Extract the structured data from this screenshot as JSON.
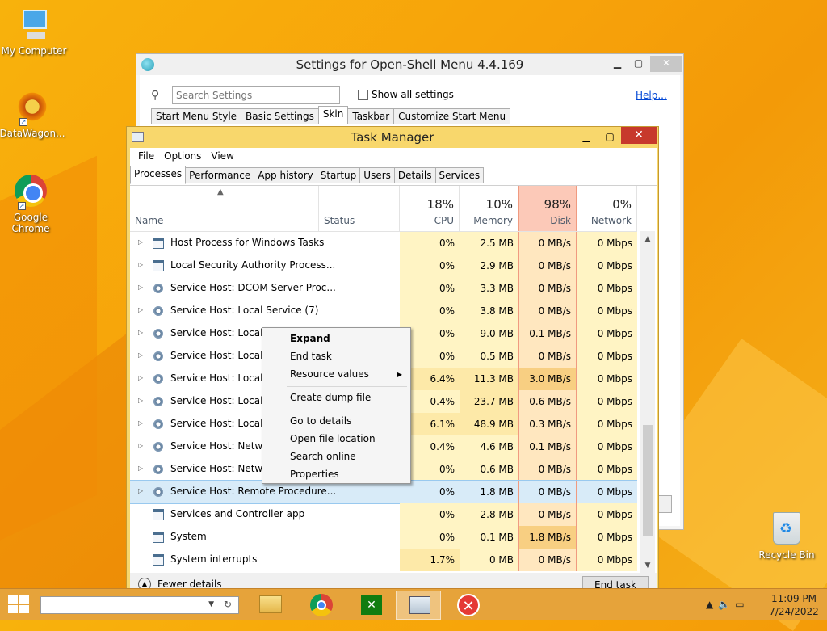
{
  "desktop": {
    "icons": [
      {
        "label": "My Computer"
      },
      {
        "label": "DataWagon..."
      },
      {
        "label": "Google Chrome"
      },
      {
        "label": "Recycle Bin"
      }
    ]
  },
  "openshell": {
    "title": "Settings for Open-Shell Menu 4.4.169",
    "search_placeholder": "Search Settings",
    "show_all_label": "Show all settings",
    "help_label": "Help...",
    "tabs": [
      "Start Menu Style",
      "Basic Settings",
      "Skin",
      "Taskbar",
      "Customize Start Menu"
    ],
    "active_tab": "Skin"
  },
  "taskmanager": {
    "title": "Task Manager",
    "menu": [
      "File",
      "Options",
      "View"
    ],
    "tabs": [
      "Processes",
      "Performance",
      "App history",
      "Startup",
      "Users",
      "Details",
      "Services"
    ],
    "active_tab": "Processes",
    "columns": {
      "name": "Name",
      "status": "Status",
      "cpu": {
        "pct": "18%",
        "label": "CPU"
      },
      "memory": {
        "pct": "10%",
        "label": "Memory"
      },
      "disk": {
        "pct": "98%",
        "label": "Disk"
      },
      "network": {
        "pct": "0%",
        "label": "Network"
      }
    },
    "rows": [
      {
        "name": "Host Process for Windows Tasks",
        "cpu": "0%",
        "mem": "2.5 MB",
        "disk": "0 MB/s",
        "net": "0 Mbps"
      },
      {
        "name": "Local Security Authority Process...",
        "cpu": "0%",
        "mem": "2.9 MB",
        "disk": "0 MB/s",
        "net": "0 Mbps"
      },
      {
        "name": "Service Host: DCOM Server Proc...",
        "cpu": "0%",
        "mem": "3.3 MB",
        "disk": "0 MB/s",
        "net": "0 Mbps"
      },
      {
        "name": "Service Host: Local Service (7)",
        "cpu": "0%",
        "mem": "3.8 MB",
        "disk": "0 MB/s",
        "net": "0 Mbps"
      },
      {
        "name": "Service Host: Local Se",
        "cpu": "0%",
        "mem": "9.0 MB",
        "disk": "0.1 MB/s",
        "net": "0 Mbps"
      },
      {
        "name": "Service Host: Local Se",
        "cpu": "0%",
        "mem": "0.5 MB",
        "disk": "0 MB/s",
        "net": "0 Mbps"
      },
      {
        "name": "Service Host: Local Se",
        "cpu": "6.4%",
        "mem": "11.3 MB",
        "disk": "3.0 MB/s",
        "net": "0 Mbps"
      },
      {
        "name": "Service Host: Local Sy",
        "cpu": "0.4%",
        "mem": "23.7 MB",
        "disk": "0.6 MB/s",
        "net": "0 Mbps"
      },
      {
        "name": "Service Host: Local Sy",
        "cpu": "6.1%",
        "mem": "48.9 MB",
        "disk": "0.3 MB/s",
        "net": "0 Mbps"
      },
      {
        "name": "Service Host: Network",
        "cpu": "0.4%",
        "mem": "4.6 MB",
        "disk": "0.1 MB/s",
        "net": "0 Mbps"
      },
      {
        "name": "Service Host: Network",
        "cpu": "0%",
        "mem": "0.6 MB",
        "disk": "0 MB/s",
        "net": "0 Mbps"
      },
      {
        "name": "Service Host: Remote Procedure...",
        "cpu": "0%",
        "mem": "1.8 MB",
        "disk": "0 MB/s",
        "net": "0 Mbps"
      },
      {
        "name": "Services and Controller app",
        "cpu": "0%",
        "mem": "2.8 MB",
        "disk": "0 MB/s",
        "net": "0 Mbps"
      },
      {
        "name": "System",
        "cpu": "0%",
        "mem": "0.1 MB",
        "disk": "1.8 MB/s",
        "net": "0 Mbps"
      },
      {
        "name": "System interrupts",
        "cpu": "1.7%",
        "mem": "0 MB",
        "disk": "0 MB/s",
        "net": "0 Mbps"
      }
    ],
    "fewer_details": "Fewer details",
    "end_task": "End task"
  },
  "context_menu": {
    "items": [
      "Expand",
      "End task",
      "Resource values",
      "Create dump file",
      "Go to details",
      "Open file location",
      "Search online",
      "Properties"
    ]
  },
  "taskbar": {
    "time": "11:09 PM",
    "date": "7/24/2022"
  }
}
